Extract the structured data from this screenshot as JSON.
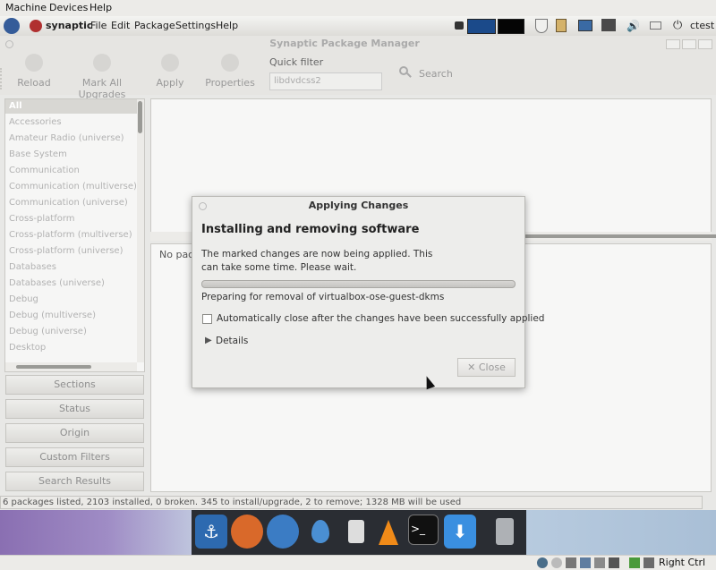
{
  "host_menu": [
    "Machine",
    "Devices",
    "Help"
  ],
  "host_statusbar": {
    "key_label": "Right Ctrl"
  },
  "top_panel": {
    "app_name": "synaptic",
    "menus": [
      "File",
      "Edit",
      "Package",
      "Settings",
      "Help"
    ],
    "user": "ctest"
  },
  "window": {
    "title": "Synaptic Package Manager"
  },
  "toolbar": {
    "reload": "Reload",
    "mark_all": "Mark All Upgrades",
    "apply": "Apply",
    "properties": "Properties",
    "quick_filter_label": "Quick filter",
    "quick_filter_value": "libdvdcss2",
    "search": "Search"
  },
  "sections": {
    "items": [
      "All",
      "Accessories",
      "Amateur Radio (universe)",
      "Base System",
      "Communication",
      "Communication (multiverse)",
      "Communication (universe)",
      "Cross-platform",
      "Cross-platform (multiverse)",
      "Cross-platform (universe)",
      "Databases",
      "Databases (universe)",
      "Debug",
      "Debug (multiverse)",
      "Debug (universe)",
      "Desktop"
    ],
    "selected": "All"
  },
  "filter_buttons": [
    "Sections",
    "Status",
    "Origin",
    "Custom Filters",
    "Search Results"
  ],
  "description": {
    "text": "No pack"
  },
  "statusbar": "6 packages listed, 2103 installed, 0 broken. 345 to install/upgrade, 2 to remove; 1328 MB will be used",
  "dialog": {
    "title": "Applying Changes",
    "heading": "Installing and removing software",
    "message": "The marked changes are now being applied. This can take some time. Please wait.",
    "progress_fraction": 0.0,
    "status": "Preparing for removal of virtualbox-ose-guest-dkms",
    "auto_close_label": "Automatically close after the changes have been successfully applied",
    "auto_close_checked": false,
    "details_label": "Details",
    "close_label": "Close"
  }
}
